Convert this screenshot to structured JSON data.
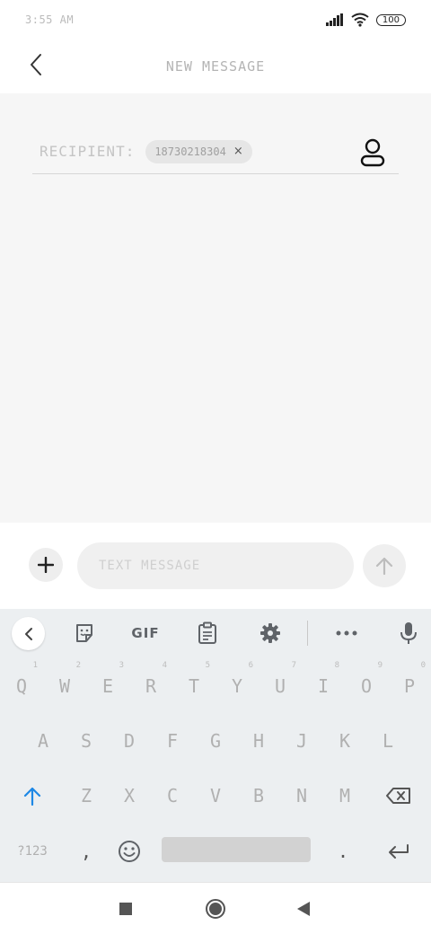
{
  "status_bar": {
    "time": "3:55 AM",
    "battery": "100"
  },
  "header": {
    "title": "NEW MESSAGE"
  },
  "recipient": {
    "label": "RECIPIENT:",
    "chip_number": "18730218304",
    "chip_close": "×"
  },
  "compose": {
    "placeholder": "TEXT MESSAGE",
    "plus": "+"
  },
  "keyboard": {
    "toolbar": {
      "gif_label": "GIF"
    },
    "row1": [
      {
        "key": "Q",
        "hint": "1"
      },
      {
        "key": "W",
        "hint": "2"
      },
      {
        "key": "E",
        "hint": "3"
      },
      {
        "key": "R",
        "hint": "4"
      },
      {
        "key": "T",
        "hint": "5"
      },
      {
        "key": "Y",
        "hint": "6"
      },
      {
        "key": "U",
        "hint": "7"
      },
      {
        "key": "I",
        "hint": "8"
      },
      {
        "key": "O",
        "hint": "9"
      },
      {
        "key": "P",
        "hint": "0"
      }
    ],
    "row2": [
      "A",
      "S",
      "D",
      "F",
      "G",
      "H",
      "J",
      "K",
      "L"
    ],
    "row3": [
      "Z",
      "X",
      "C",
      "V",
      "B",
      "N",
      "M"
    ],
    "row4": {
      "symbols": "?123",
      "comma": ",",
      "period": "."
    }
  },
  "colors": {
    "accent": "#1e88e5",
    "content_bg": "#f6f6f6",
    "keyboard_bg": "#eceff1"
  }
}
